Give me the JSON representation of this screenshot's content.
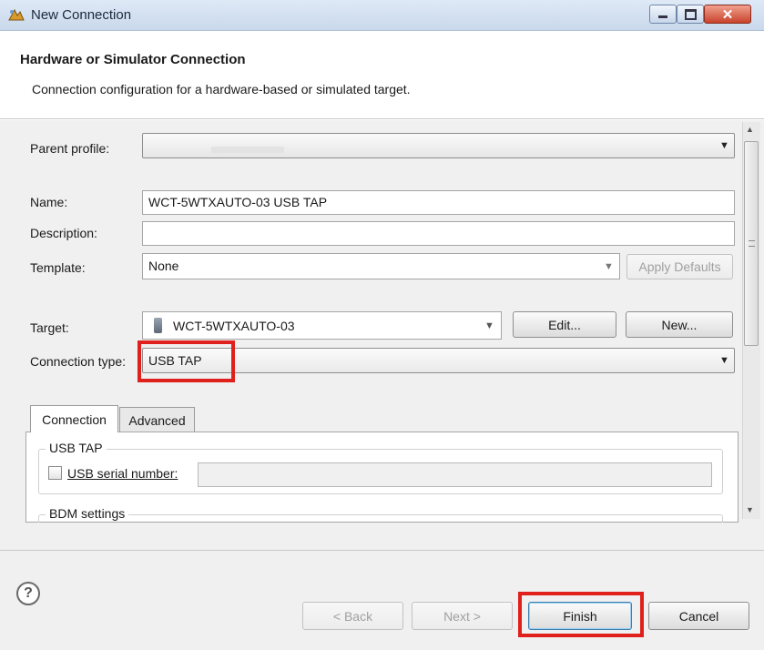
{
  "window": {
    "title": "New Connection"
  },
  "header": {
    "title": "Hardware or Simulator Connection",
    "subtitle": "Connection configuration for a hardware-based or simulated target."
  },
  "form": {
    "parent_profile_label": "Parent profile:",
    "parent_profile_value": "",
    "name_label": "Name:",
    "name_value": "WCT-5WTXAUTO-03 USB TAP",
    "description_label": "Description:",
    "description_value": "",
    "template_label": "Template:",
    "template_value": "None",
    "apply_defaults_label": "Apply Defaults",
    "target_label": "Target:",
    "target_value": "WCT-5WTXAUTO-03",
    "edit_label": "Edit...",
    "new_label": "New...",
    "connection_type_label": "Connection type:",
    "connection_type_value": "USB TAP"
  },
  "tabs": [
    {
      "label": "Connection",
      "selected": true
    },
    {
      "label": "Advanced",
      "selected": false
    }
  ],
  "connection_tab": {
    "usb_tap_group": "USB TAP",
    "usb_serial_label": "USB serial number:",
    "usb_serial_checked": false,
    "usb_serial_value": "",
    "bdm_group": "BDM settings"
  },
  "footer": {
    "back_label": "< Back",
    "next_label": "Next >",
    "finish_label": "Finish",
    "cancel_label": "Cancel"
  },
  "colors": {
    "highlight": "#e0201c",
    "titlebar": "#c9d8ec",
    "dialog_bg": "#f0f0f0"
  }
}
